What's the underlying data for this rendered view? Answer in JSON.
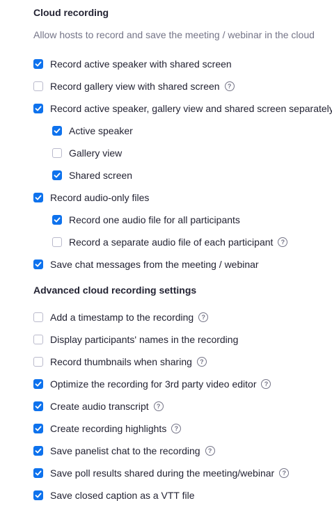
{
  "cloud": {
    "title": "Cloud recording",
    "description": "Allow hosts to record and save the meeting / webinar in the cloud",
    "options": [
      {
        "label": "Record active speaker with shared screen",
        "checked": true,
        "help": false,
        "level": 0
      },
      {
        "label": "Record gallery view with shared screen",
        "checked": false,
        "help": true,
        "level": 0
      },
      {
        "label": "Record active speaker, gallery view and shared screen separately",
        "checked": true,
        "help": false,
        "level": 0
      },
      {
        "label": "Active speaker",
        "checked": true,
        "help": false,
        "level": 1
      },
      {
        "label": "Gallery view",
        "checked": false,
        "help": false,
        "level": 1
      },
      {
        "label": "Shared screen",
        "checked": true,
        "help": false,
        "level": 1
      },
      {
        "label": "Record audio-only files",
        "checked": true,
        "help": false,
        "level": 0
      },
      {
        "label": "Record one audio file for all participants",
        "checked": true,
        "help": false,
        "level": 1
      },
      {
        "label": "Record a separate audio file of each participant",
        "checked": false,
        "help": true,
        "level": 1
      },
      {
        "label": "Save chat messages from the meeting / webinar",
        "checked": true,
        "help": false,
        "level": 0
      }
    ]
  },
  "advanced": {
    "title": "Advanced cloud recording settings",
    "options": [
      {
        "label": "Add a timestamp to the recording",
        "checked": false,
        "help": true,
        "level": 0
      },
      {
        "label": "Display participants' names in the recording",
        "checked": false,
        "help": false,
        "level": 0
      },
      {
        "label": "Record thumbnails when sharing",
        "checked": false,
        "help": true,
        "level": 0
      },
      {
        "label": "Optimize the recording for 3rd party video editor",
        "checked": true,
        "help": true,
        "level": 0
      },
      {
        "label": "Create audio transcript",
        "checked": true,
        "help": true,
        "level": 0
      },
      {
        "label": "Create recording highlights",
        "checked": true,
        "help": true,
        "level": 0
      },
      {
        "label": "Save panelist chat to the recording",
        "checked": true,
        "help": true,
        "level": 0
      },
      {
        "label": "Save poll results shared during the meeting/webinar",
        "checked": true,
        "help": true,
        "level": 0
      },
      {
        "label": "Save closed caption as a VTT file",
        "checked": true,
        "help": false,
        "level": 0
      }
    ]
  },
  "help_glyph": "?",
  "colors": {
    "accent": "#0e72ed",
    "text": "#232333",
    "muted": "#747487"
  }
}
